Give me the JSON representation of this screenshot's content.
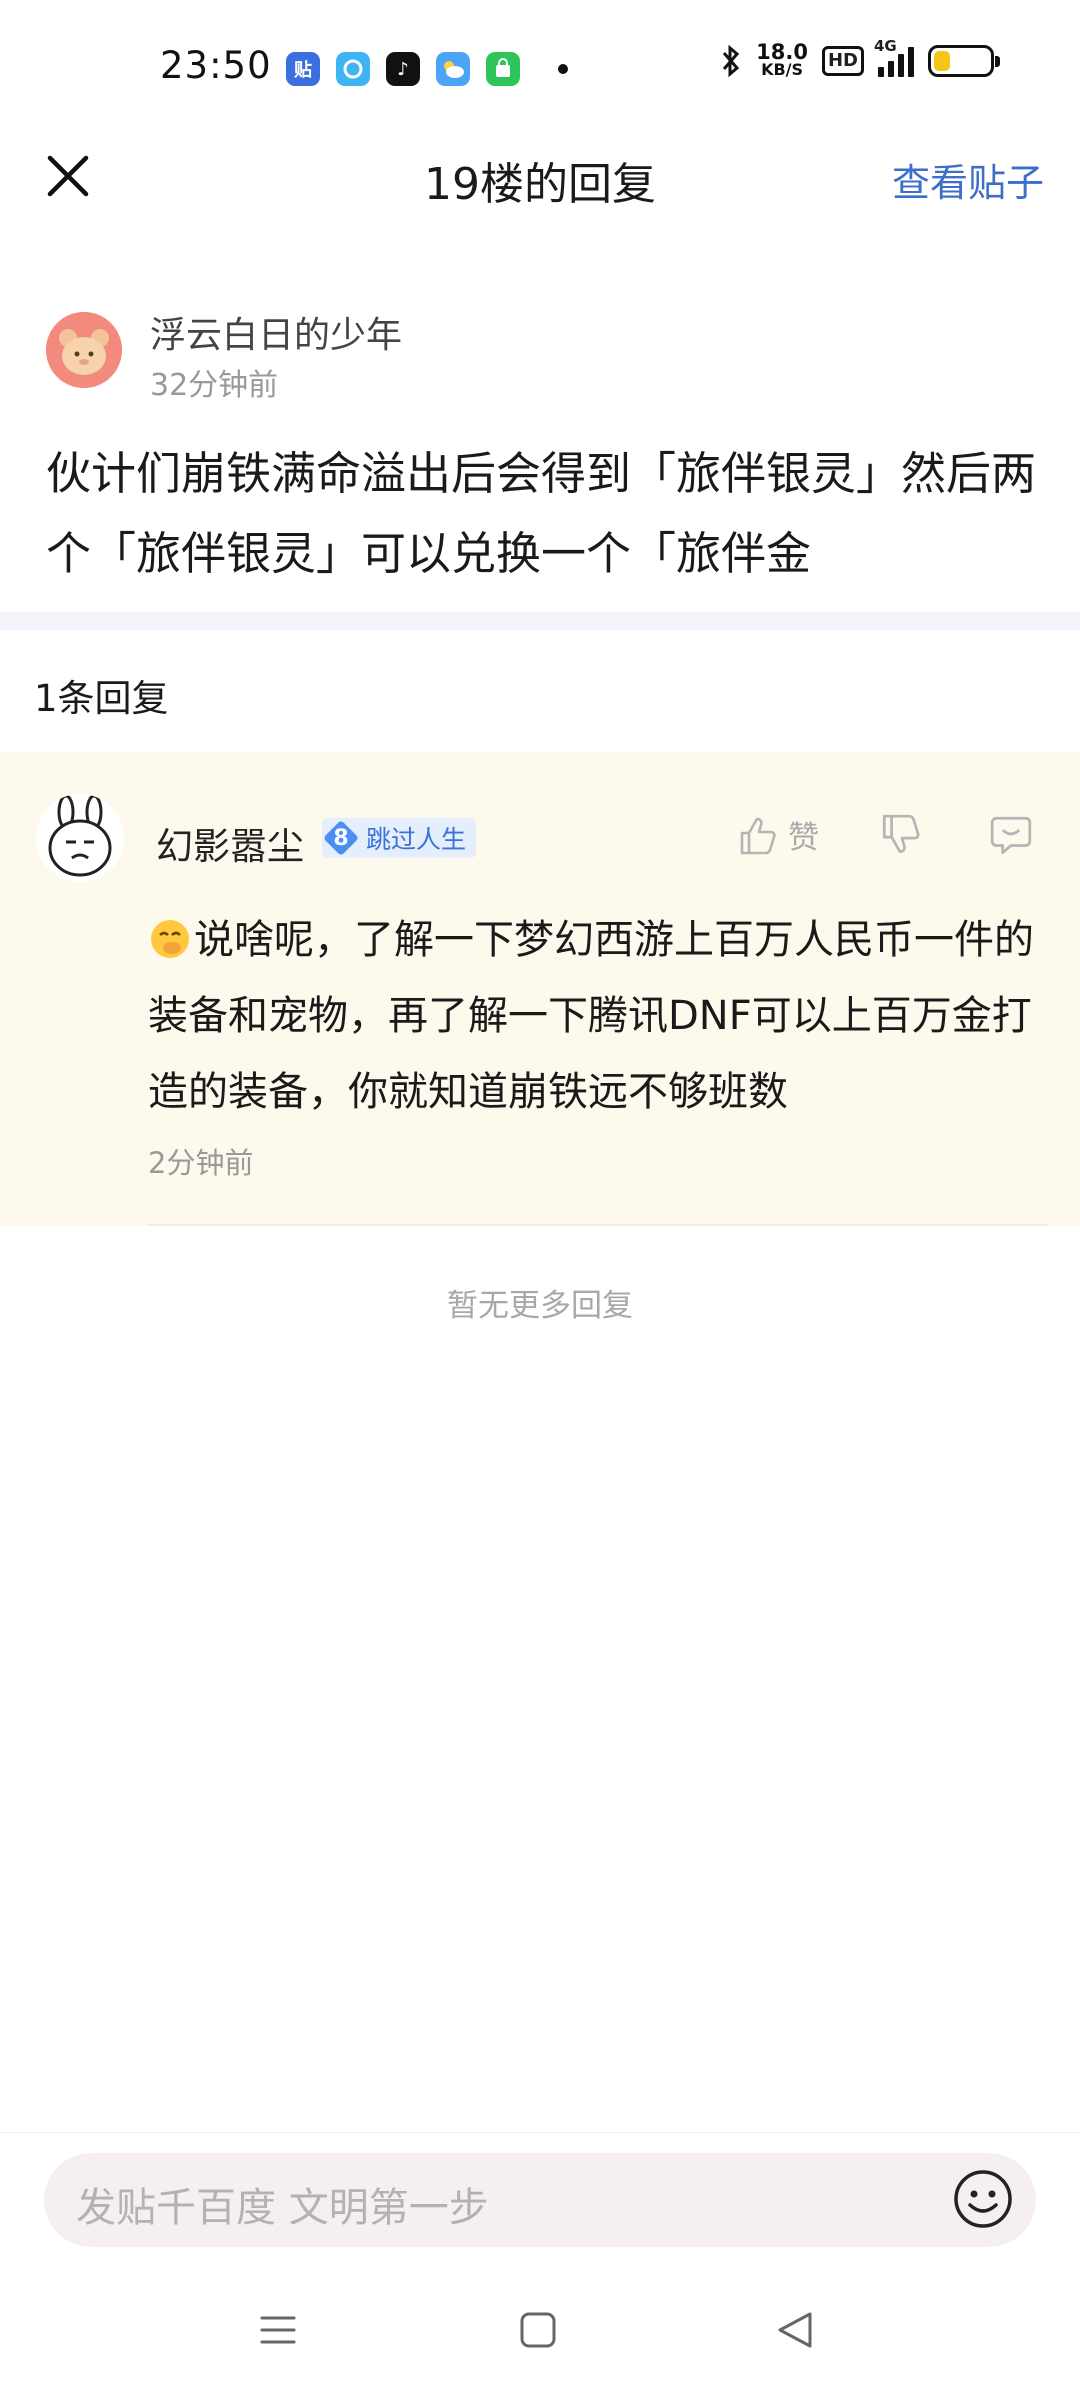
{
  "status_bar": {
    "time": "23:50",
    "apps": [
      {
        "name": "tieba-app-icon",
        "glyph": "贴",
        "color": "#3b6fe0"
      },
      {
        "name": "browser-app-icon",
        "glyph": "",
        "color": "#3fb4f4"
      },
      {
        "name": "douyin-app-icon",
        "glyph": "♪",
        "color": "#111111"
      },
      {
        "name": "weather-app-icon",
        "glyph": "",
        "color": "#4aa4f7"
      },
      {
        "name": "shop-app-icon",
        "glyph": "",
        "color": "#2fc45a"
      }
    ],
    "speed_value": "18.0",
    "speed_unit": "KB/S",
    "hd": "HD",
    "network": "4G",
    "battery_level": 0.3
  },
  "header": {
    "title": "19楼的回复",
    "view_post_label": "查看贴子"
  },
  "post": {
    "author": "浮云白日的少年",
    "time": "32分钟前",
    "text": "伙计们崩铁满命溢出后会得到「旅伴银灵」然后两个「旅伴银灵」可以兑换一个「旅伴金"
  },
  "reply_count_label": "1条回复",
  "reply": {
    "author": "幻影嚣尘",
    "level": "8",
    "level_name": "跳过人生",
    "like_label": "赞",
    "text": "说啥呢，了解一下梦幻西游上百万人民币一件的装备和宠物，再了解一下腾讯DNF可以上百万金打造的装备，你就知道崩铁远不够班数",
    "time": "2分钟前"
  },
  "no_more_label": "暂无更多回复",
  "composer": {
    "placeholder": "发贴千百度 文明第一步"
  }
}
